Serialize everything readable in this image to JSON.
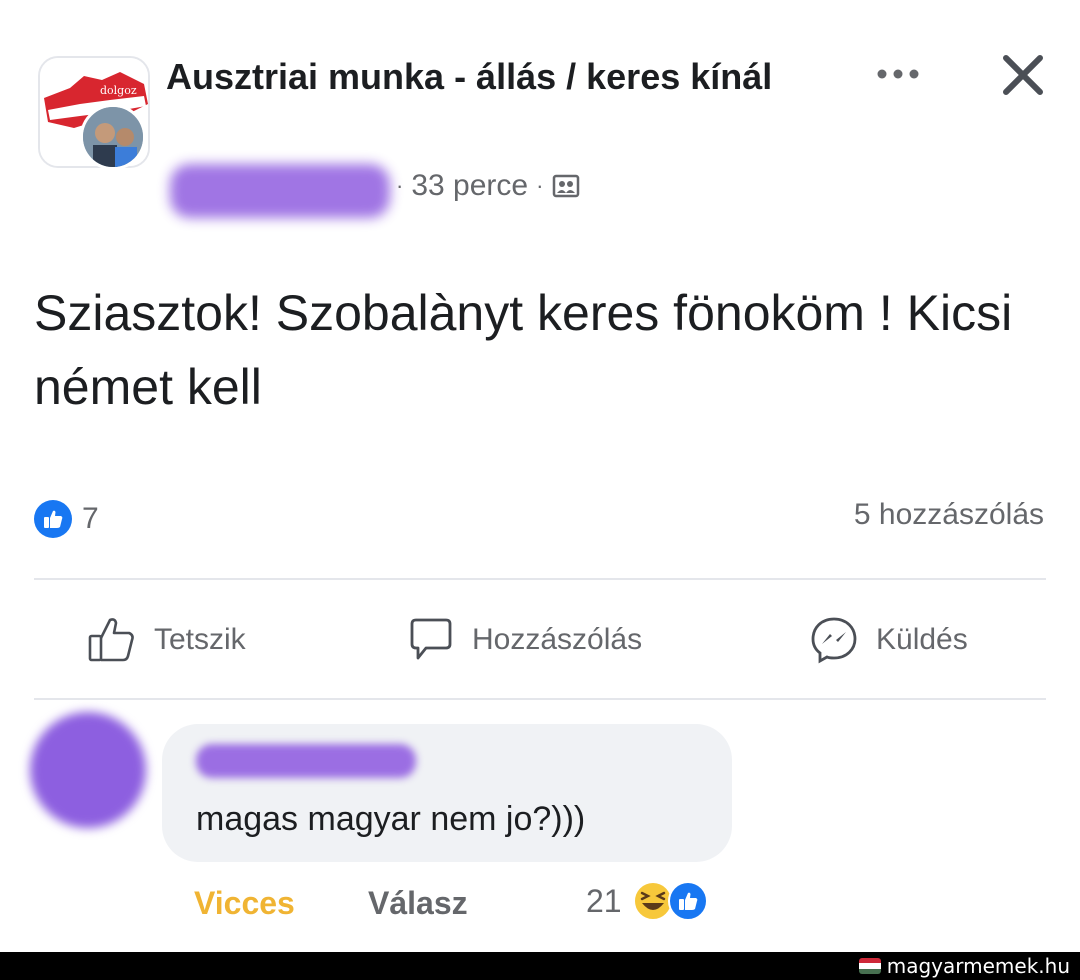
{
  "header": {
    "group_title": "Ausztriai munka - állás / keres kínál",
    "time_ago": "33 perce",
    "separator": "·",
    "more_icon": "more-horizontal-icon",
    "close_icon": "close-icon",
    "privacy_icon": "group-members-icon"
  },
  "post": {
    "text": "Sziasztok! Szobalànyt keres fönoköm ! Kicsi német kell"
  },
  "stats": {
    "reaction_count": "7",
    "comments_label": "5 hozzászólás"
  },
  "actions": {
    "like_label": "Tetszik",
    "comment_label": "Hozzászólás",
    "send_label": "Küldés"
  },
  "comment": {
    "text": "magas magyar nem jo?)))",
    "react_label": "Vicces",
    "reply_label": "Válasz",
    "reaction_count": "21"
  },
  "watermark": {
    "text": "magyarmemek.hu"
  },
  "colors": {
    "like_blue": "#1877f2",
    "haha_yellow": "#f0b433",
    "redaction_purple": "#9b6ee3",
    "muted_text": "#65676b"
  }
}
